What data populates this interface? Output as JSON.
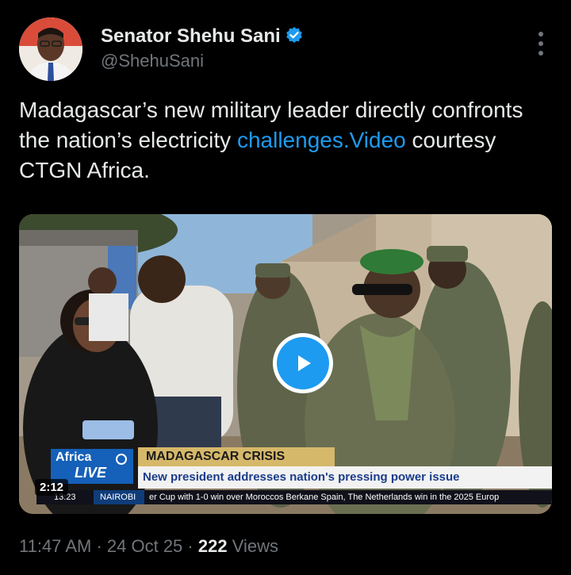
{
  "author": {
    "name": "Senator Shehu Sani",
    "handle": "@ShehuSani",
    "verified_color": "#1d9bf0"
  },
  "tweet": {
    "text_plain": "Madagascar’s new military leader directly confronts the nation’s electricity ",
    "link_text": "challenges.Video",
    "text_tail": " courtesy CTGN Africa."
  },
  "video": {
    "duration": "2:12",
    "overlay": {
      "brand_top": "Africa",
      "brand_bottom": "LIVE",
      "banner": "MADAGASCAR CRISIS",
      "headline": "New president addresses nation's pressing power issue",
      "ticker_time": "13:23",
      "ticker_city": "NAIROBI",
      "ticker_text": "er Cup with 1-0 win over Moroccos Berkane          Spain, The Netherlands win in the 2025 Europ"
    },
    "play_icon": "play-icon"
  },
  "meta": {
    "time": "11:47 AM",
    "separator": "·",
    "date": "24 Oct 25",
    "views_count": "222",
    "views_label": "Views"
  },
  "colors": {
    "background": "#000000",
    "link": "#1d9bf0",
    "muted": "#71767b",
    "text": "#e7e9ea"
  }
}
